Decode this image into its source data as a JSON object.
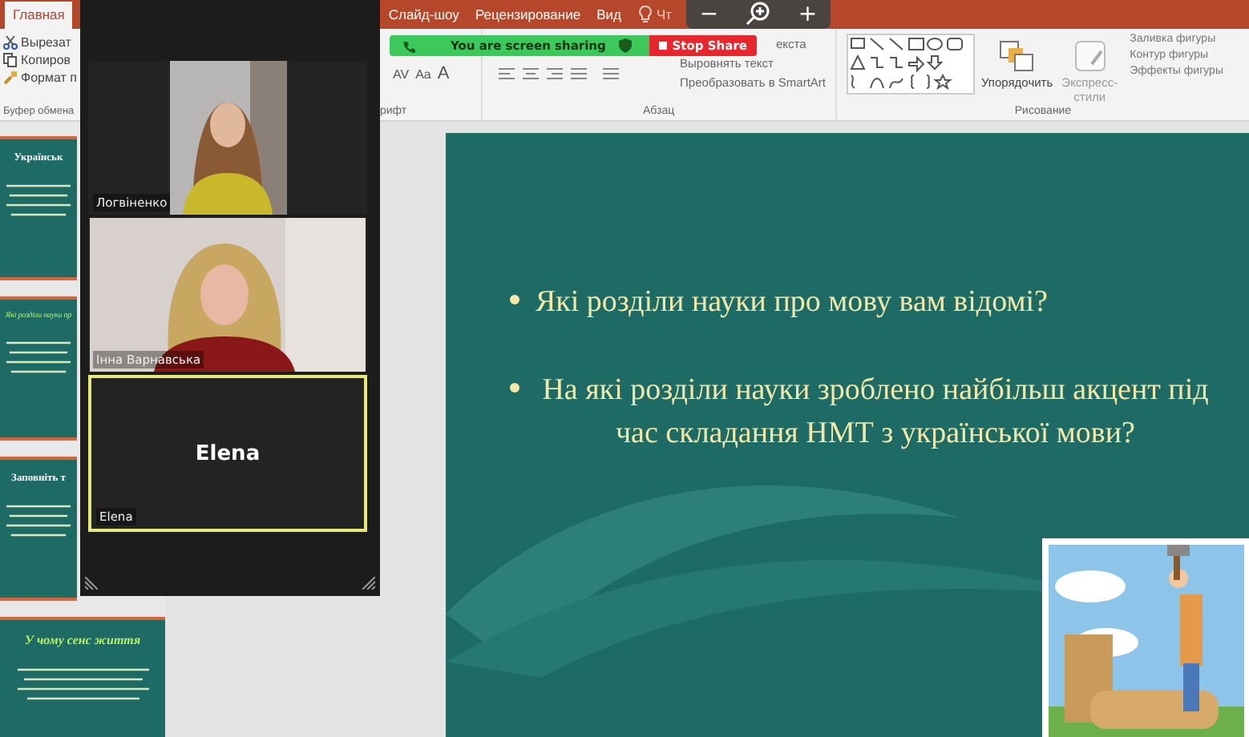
{
  "ribbon": {
    "tabs": [
      {
        "label": "Главная",
        "selected": true
      },
      {
        "label": "Слайд-шоу",
        "selected": false
      },
      {
        "label": "Рецензирование",
        "selected": false
      },
      {
        "label": "Вид",
        "selected": false
      }
    ],
    "tell_me": "Чт",
    "clipboard": {
      "commands": [
        "Вырезат",
        "Копиров",
        "Формат п"
      ],
      "label": "Буфер обмена"
    },
    "font": {
      "buttons": [
        "AV",
        "Aa",
        "A"
      ],
      "label": "рифт"
    },
    "paragraph": {
      "commands": [
        "екста",
        "Выровнять текст",
        "Преобразовать в SmartArt"
      ],
      "label": "Абзац"
    },
    "drawing": {
      "arrange": "Упорядочить",
      "styles": "Экспресс-стили",
      "commands": [
        "Заливка фигуры",
        "Контур фигуры",
        "Эффекты фигуры"
      ],
      "label": "Рисование"
    }
  },
  "zoom_controls": [
    "−",
    "+"
  ],
  "share_bar": {
    "status": "You are screen sharing",
    "stop": "Stop Share"
  },
  "thumbnails": [
    {
      "title": "Українськ"
    },
    {
      "title": "Які розділи науки пр"
    },
    {
      "title": "Заповніть т"
    },
    {
      "title": "У чому сенс життя"
    }
  ],
  "gallery": {
    "tiles": [
      {
        "name": "Логвіненко",
        "kind": "video",
        "active": false
      },
      {
        "name": "Інна Варнавська",
        "kind": "video",
        "active": false
      },
      {
        "name": "Elena",
        "kind": "avatar",
        "active": true,
        "display": "Elena"
      }
    ]
  },
  "slide": {
    "bullets": [
      "Які розділи науки про мову вам відомі?",
      "На які розділи науки зроблено найбільш акцент під час складання НМТ з української мови?"
    ],
    "picture": {
      "kind": "picture"
    }
  }
}
